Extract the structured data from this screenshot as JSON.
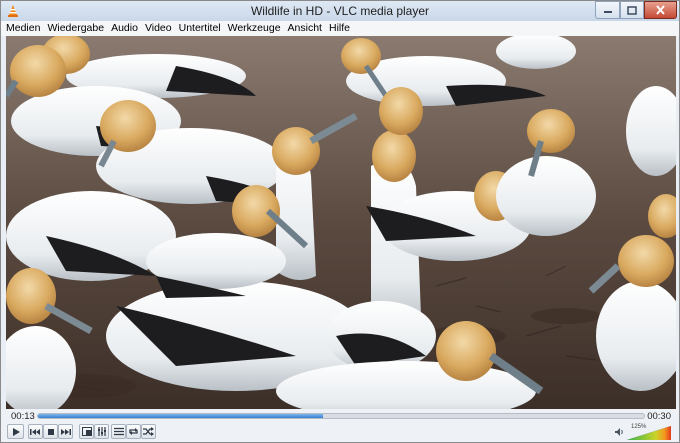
{
  "window": {
    "title": "Wildlife in HD - VLC media player",
    "icon": "vlc-cone-icon"
  },
  "menubar": {
    "items": [
      "Medien",
      "Wiedergabe",
      "Audio",
      "Video",
      "Untertitel",
      "Werkzeuge",
      "Ansicht",
      "Hilfe"
    ]
  },
  "player": {
    "current_time": "00:13",
    "total_time": "00:30",
    "progress_fraction": 0.47,
    "volume_label": "125%",
    "volume_fraction": 1.0
  },
  "controls": {
    "icons": [
      "play-icon",
      "previous-icon",
      "stop-icon",
      "next-icon",
      "fullscreen-icon",
      "extended-settings-icon",
      "playlist-icon",
      "loop-icon",
      "shuffle-icon"
    ]
  },
  "colors": {
    "seek_fill": "#3a7fce",
    "close_button": "#c44a34"
  }
}
